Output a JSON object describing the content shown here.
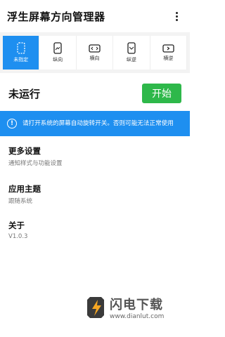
{
  "app": {
    "title": "浮生屏幕方向管理器"
  },
  "modes": [
    {
      "label": "未指定",
      "icon": "unspecified-icon",
      "active": true
    },
    {
      "label": "纵向",
      "icon": "portrait-icon",
      "active": false
    },
    {
      "label": "横向",
      "icon": "landscape-icon",
      "active": false
    },
    {
      "label": "纵逆",
      "icon": "reverse-portrait-icon",
      "active": false
    },
    {
      "label": "横逆",
      "icon": "reverse-landscape-icon",
      "active": false
    }
  ],
  "status": {
    "text": "未运行",
    "start_label": "开始"
  },
  "notice": {
    "text": "请打开系统的屏幕自动旋转开关。否则可能无法正常使用"
  },
  "settings": {
    "more": {
      "title": "更多设置",
      "subtitle": "通知样式与功能设置"
    },
    "theme": {
      "title": "应用主题",
      "subtitle": "跟随系统"
    },
    "about": {
      "title": "关于",
      "subtitle": "V1.0.3"
    }
  },
  "watermark": {
    "brand": "闪电下载",
    "url": "www.dianlut.com"
  },
  "colors": {
    "accent": "#1e8ff0",
    "start": "#2eb84a"
  }
}
